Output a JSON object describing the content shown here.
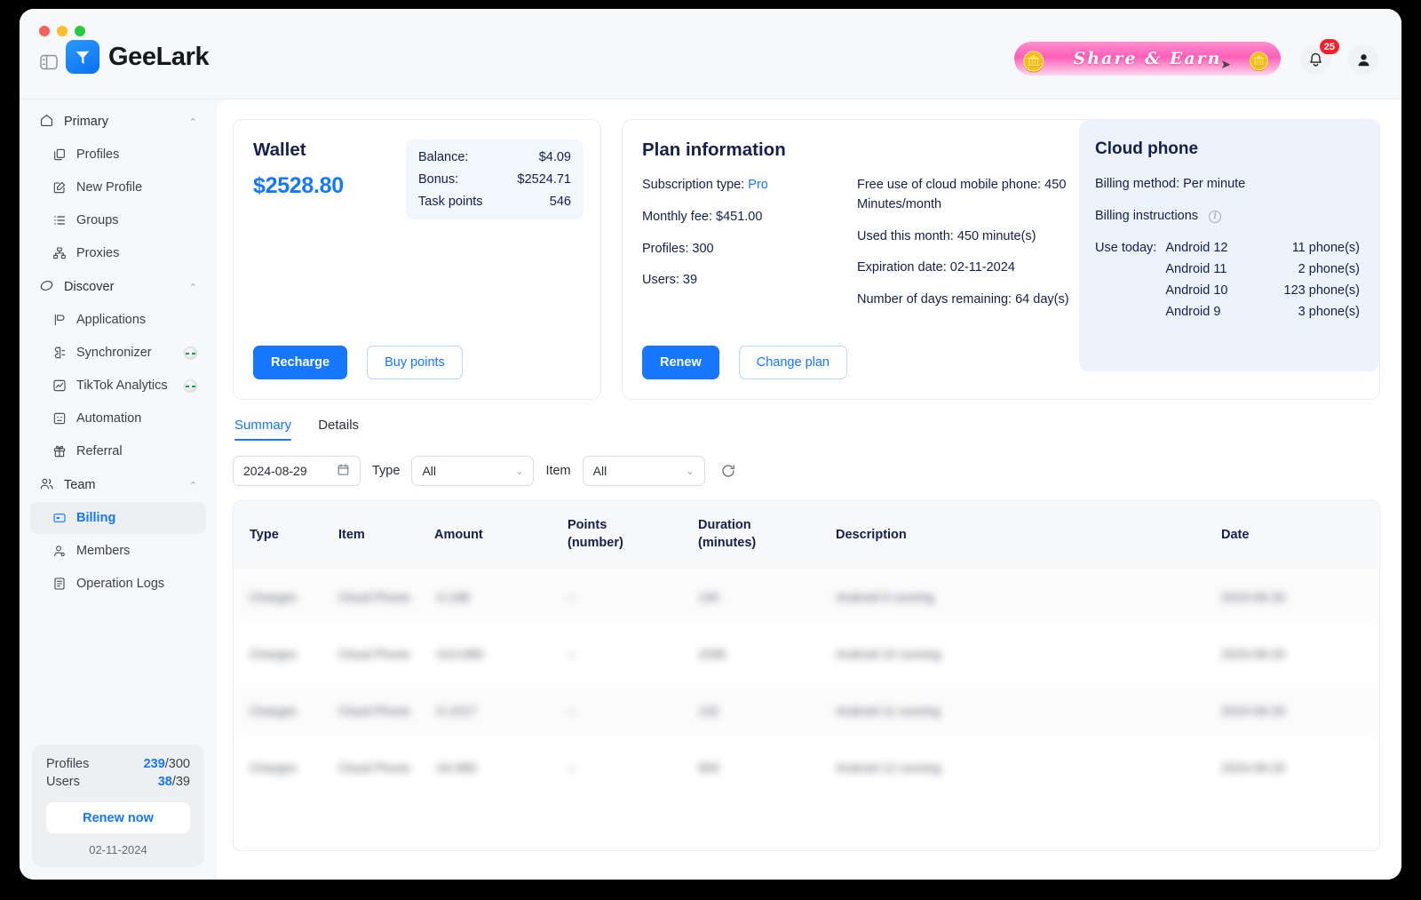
{
  "app": {
    "brand_name": "GeeLark",
    "panel_toggle_icon": "sidebar-toggle-icon",
    "logo_icon": "geelark-logo-icon"
  },
  "header": {
    "share_banner": {
      "label": "Share  &  Earn",
      "coin_left_icon": "coins-icon",
      "coin_right_icon": "coins-icon",
      "cursor_icon": "cursor-arrow-icon"
    },
    "notifications": {
      "icon": "bell-icon",
      "badge_count": "25"
    },
    "avatar_icon": "user-avatar-icon"
  },
  "sidebar": {
    "groups": [
      {
        "label": "Primary",
        "icon": "home-icon",
        "chevron": "chevron-up-icon",
        "items": [
          {
            "label": "Profiles",
            "icon": "profiles-icon"
          },
          {
            "label": "New Profile",
            "icon": "new-profile-icon"
          },
          {
            "label": "Groups",
            "icon": "list-icon"
          },
          {
            "label": "Proxies",
            "icon": "proxies-icon"
          }
        ]
      },
      {
        "label": "Discover",
        "icon": "discover-icon",
        "chevron": "chevron-up-icon",
        "items": [
          {
            "label": "Applications",
            "icon": "applications-icon"
          },
          {
            "label": "Synchronizer",
            "icon": "synchronizer-icon",
            "badge": true
          },
          {
            "label": "TikTok Analytics",
            "icon": "analytics-icon",
            "badge": true
          },
          {
            "label": "Automation",
            "icon": "automation-icon"
          },
          {
            "label": "Referral",
            "icon": "gift-icon"
          }
        ]
      },
      {
        "label": "Team",
        "icon": "team-icon",
        "chevron": "chevron-up-icon",
        "items": [
          {
            "label": "Billing",
            "icon": "billing-icon",
            "active": true
          },
          {
            "label": "Members",
            "icon": "member-icon"
          },
          {
            "label": "Operation Logs",
            "icon": "logs-icon"
          }
        ]
      }
    ],
    "footer": {
      "profiles_label": "Profiles",
      "profiles_used": "239",
      "profiles_total": "/300",
      "users_label": "Users",
      "users_used": "38",
      "users_total": "/39",
      "renew_button": "Renew now",
      "date": "02-11-2024"
    }
  },
  "wallet": {
    "title": "Wallet",
    "amount": "$2528.80",
    "stats": [
      {
        "label": "Balance:",
        "value": "$4.09"
      },
      {
        "label": "Bonus:",
        "value": "$2524.71"
      },
      {
        "label": "Task points",
        "value": "546"
      }
    ],
    "recharge_button": "Recharge",
    "buy_points_button": "Buy points"
  },
  "plan": {
    "title": "Plan information",
    "subscription_label": "Subscription type:",
    "subscription_value": "Pro",
    "monthly_fee": "Monthly fee: $451.00",
    "profiles": "Profiles: 300",
    "users": "Users: 39",
    "free_use": "Free use of cloud mobile phone: 450 Minutes/month",
    "used_this_month": "Used this month: 450 minute(s)",
    "expiration": "Expiration date: 02-11-2024",
    "days_remaining": "Number of days remaining: 64 day(s)",
    "renew_button": "Renew",
    "change_plan_button": "Change plan",
    "info_icon": "info-circle-icon"
  },
  "cloud_phone": {
    "title": "Cloud phone",
    "billing_method": "Billing method:  Per minute",
    "billing_instructions": "Billing instructions",
    "info_icon": "info-circle-icon",
    "use_today_label": "Use today:",
    "use_today": [
      {
        "os": "Android 12",
        "count": "11 phone(s)"
      },
      {
        "os": "Android 11",
        "count": "2 phone(s)"
      },
      {
        "os": "Android 10",
        "count": "123 phone(s)"
      },
      {
        "os": "Android 9",
        "count": "3 phone(s)"
      }
    ]
  },
  "tabs": [
    {
      "label": "Summary",
      "active": true
    },
    {
      "label": "Details",
      "active": false
    }
  ],
  "filters": {
    "date_value": "2024-08-29",
    "date_icon": "calendar-icon",
    "type_label": "Type",
    "type_value": "All",
    "item_label": "Item",
    "item_value": "All",
    "caret_icon": "chevron-down-icon",
    "refresh_icon": "refresh-icon"
  },
  "table": {
    "columns": [
      {
        "line1": "Type",
        "line2": ""
      },
      {
        "line1": "Item",
        "line2": ""
      },
      {
        "line1": "Amount",
        "line2": ""
      },
      {
        "line1": "Points",
        "line2": "(number)"
      },
      {
        "line1": "Duration",
        "line2": "(minutes)"
      },
      {
        "line1": "Description",
        "line2": ""
      },
      {
        "line1": "Date",
        "line2": ""
      }
    ],
    "rows": [
      {
        "type": "Charges",
        "item": "Cloud Phone",
        "amount": "-0.188",
        "points": "--",
        "duration": "130",
        "description": "Android 9 running",
        "date": "2024-08-29"
      },
      {
        "type": "Charges",
        "item": "Cloud Phone",
        "amount": "-013.880",
        "points": "--",
        "duration": "1006",
        "description": "Android 10 running",
        "date": "2024-08-29"
      },
      {
        "type": "Charges",
        "item": "Cloud Phone",
        "amount": "-0.1017",
        "points": "--",
        "duration": "132",
        "description": "Android 11 running",
        "date": "2024-08-29"
      },
      {
        "type": "Charges",
        "item": "Cloud Phone",
        "amount": "-04.980",
        "points": "--",
        "duration": "909",
        "description": "Android 12 running",
        "date": "2024-08-29"
      }
    ]
  },
  "colors": {
    "accent": "#1677ff",
    "danger": "#f5222d",
    "heading": "#15204a",
    "surface": "#ffffff",
    "app_bg": "#f7f8f9",
    "tint": "#edf3fd"
  }
}
